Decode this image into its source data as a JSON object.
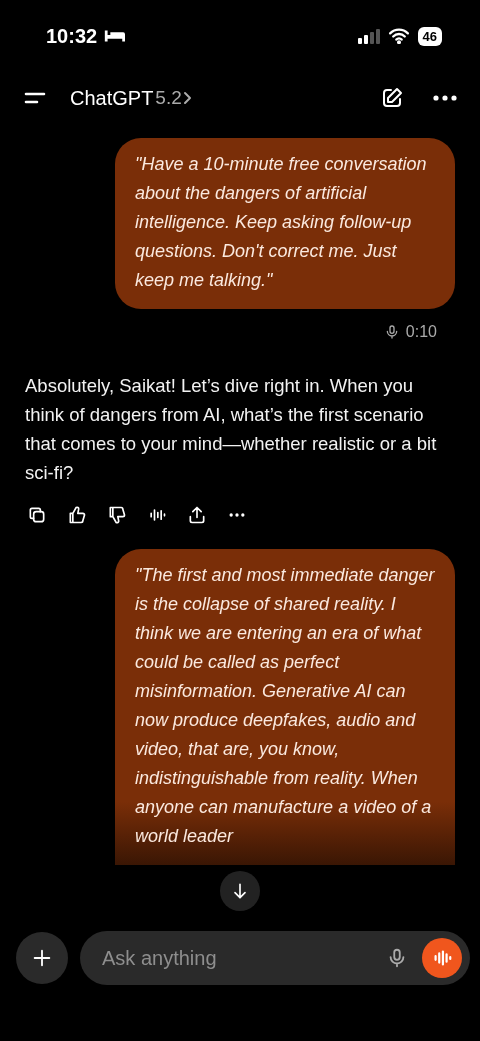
{
  "status_bar": {
    "time": "10:32",
    "battery": "46"
  },
  "header": {
    "title": "ChatGPT",
    "version": "5.2"
  },
  "messages": [
    {
      "kind": "user",
      "text": "\"Have a 10-minute free conversation about the dangers of artificial intelligence. Keep asking follow-up questions. Don't correct me. Just keep me talking.\"",
      "duration": "0:10"
    },
    {
      "kind": "assistant",
      "text": "Absolutely, Saikat! Let’s dive right in. When you think of dangers from AI, what’s the first scenario that comes to your mind—whether realistic or a bit sci-fi?"
    },
    {
      "kind": "user",
      "text": "\"The first and most immediate danger is the collapse of shared reality. I think we are entering an era of what could be called as perfect misinformation. Generative AI can now produce deepfakes, audio and video, that are, you know, indistinguishable from reality. When anyone can manufacture a video of a world leader"
    }
  ],
  "composer": {
    "placeholder": "Ask anything"
  }
}
